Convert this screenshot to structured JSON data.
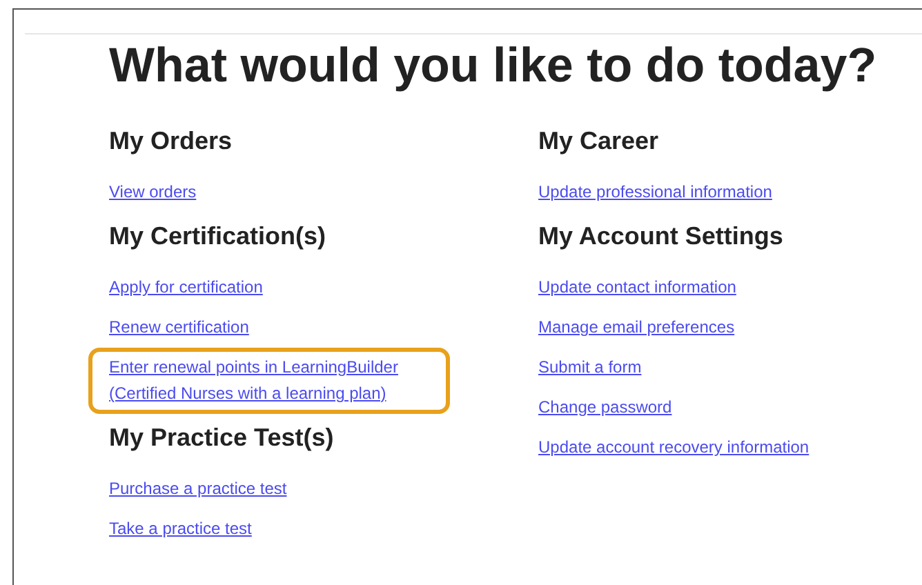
{
  "title": "What would you like to do today?",
  "columns": [
    {
      "sections": [
        {
          "heading": "My Orders",
          "links": [
            {
              "label": "View orders",
              "highlighted": false
            }
          ]
        },
        {
          "heading": "My Certification(s)",
          "links": [
            {
              "label": "Apply for certification",
              "highlighted": false
            },
            {
              "label": "Renew certification",
              "highlighted": false
            },
            {
              "label": "Enter renewal points in LearningBuilder (Certified Nurses with a learning plan)",
              "highlighted": true
            }
          ]
        },
        {
          "heading": "My Practice Test(s)",
          "links": [
            {
              "label": "Purchase a practice test",
              "highlighted": false
            },
            {
              "label": "Take a practice test",
              "highlighted": false
            }
          ]
        }
      ]
    },
    {
      "sections": [
        {
          "heading": "My Career",
          "links": [
            {
              "label": "Update professional information",
              "highlighted": false
            }
          ]
        },
        {
          "heading": "My Account Settings",
          "links": [
            {
              "label": "Update contact information",
              "highlighted": false
            },
            {
              "label": "Manage email preferences",
              "highlighted": false
            },
            {
              "label": "Submit a form",
              "highlighted": false
            },
            {
              "label": "Change password",
              "highlighted": false
            },
            {
              "label": "Update account recovery information",
              "highlighted": false
            }
          ]
        }
      ]
    }
  ]
}
